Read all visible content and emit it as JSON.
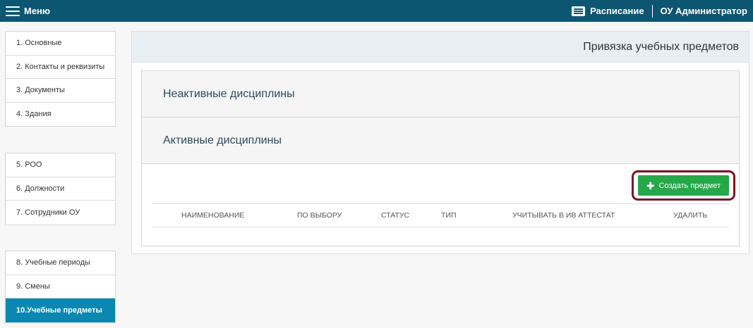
{
  "topbar": {
    "menu_label": "Меню",
    "schedule_label": "Расписание",
    "user_label": "ОУ Администратор"
  },
  "sidebar": {
    "groups": [
      [
        "1.  Основные",
        "2.  Контакты и реквизиты",
        "3.  Документы",
        "4.  Здания"
      ],
      [
        "5.  РОО",
        "6.  Должности",
        "7.  Сотрудники ОУ"
      ],
      [
        "8.  Учебные периоды",
        "9.  Смены",
        "10.Учебные предметы"
      ]
    ],
    "active_item": "10.Учебные предметы"
  },
  "main": {
    "title": "Привязка учебных предметов",
    "inactive_panel": "Неактивные дисциплины",
    "active_panel": "Активные дисциплины",
    "create_button": "Создать предмет",
    "columns": [
      "НАИМЕНОВАНИЕ",
      "ПО ВЫБОРУ",
      "СТАТУС",
      "ТИП",
      "УЧИТЫВАТЬ В ИВ АТТЕСТАТ",
      "УДАЛИТЬ"
    ]
  },
  "colors": {
    "topbar": "#0d5672",
    "active_item": "#0a88b2",
    "create_button": "#26a748",
    "highlight_border": "#7b1226"
  },
  "icons": [
    "hamburger-icon",
    "schedule-icon",
    "plus-icon"
  ]
}
